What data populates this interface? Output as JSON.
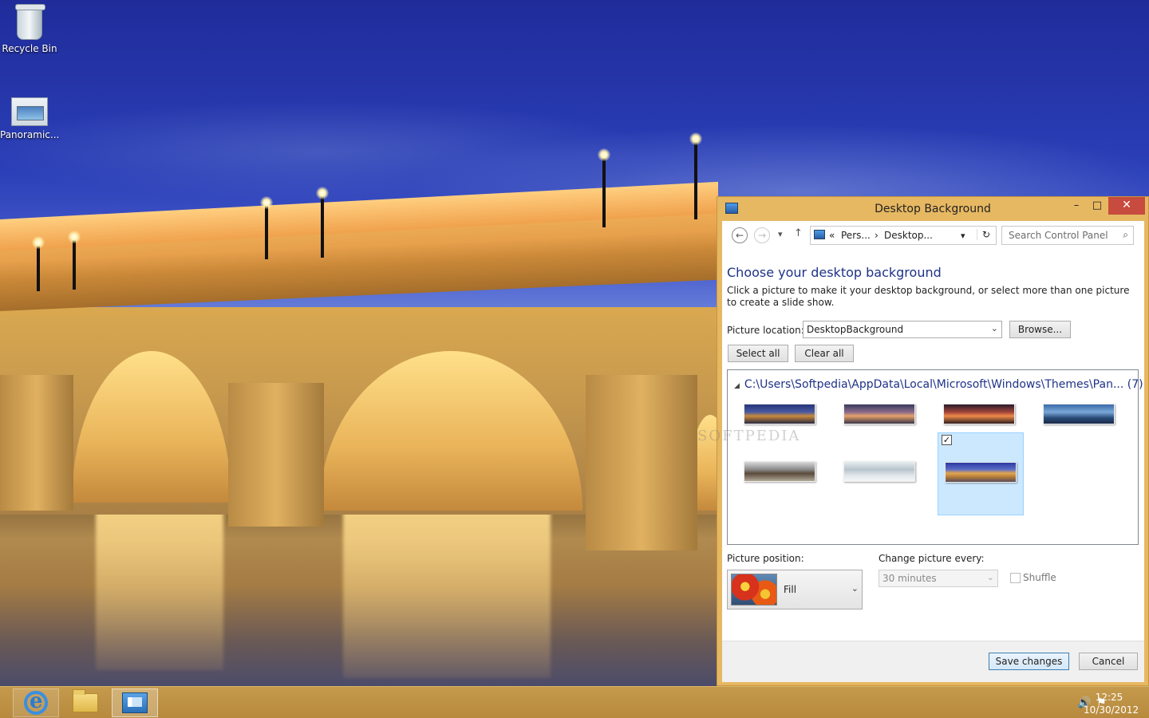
{
  "desktop": {
    "icons": [
      {
        "label": "Recycle Bin",
        "icon": "recycle-bin-icon"
      },
      {
        "label": "Panoramic...",
        "icon": "theme-pack-icon"
      }
    ]
  },
  "window": {
    "title": "Desktop Background",
    "controls": {
      "minimize": "–",
      "maximize": "□",
      "close": "✕"
    },
    "nav": {
      "back": "←",
      "forward": "→",
      "recent": "▾",
      "up": "↑",
      "address_sep": "«",
      "crumbs": [
        "Pers...",
        "Desktop..."
      ],
      "crumb_sep": "›",
      "dropdown": "▾",
      "refresh": "↻",
      "search_placeholder": "Search Control Panel",
      "search_icon": "⌕"
    },
    "heading": "Choose your desktop background",
    "description": "Click a picture to make it your desktop background, or select more than one picture to create a slide show.",
    "picture_location_label": "Picture location:",
    "picture_location_value": "DesktopBackground",
    "browse_label": "Browse...",
    "select_all_label": "Select all",
    "clear_all_label": "Clear all",
    "gallery": {
      "group_toggle": "◢",
      "group_path": "C:\\Users\\Softpedia\\AppData\\Local\\Microsoft\\Windows\\Themes\\Pan... (7)",
      "watermark": "SOFTPEDIA",
      "thumbnails": [
        {
          "name": "bridge-night",
          "selected": false
        },
        {
          "name": "bridge-sunset",
          "selected": false
        },
        {
          "name": "ferris-wheel-sunset",
          "selected": false
        },
        {
          "name": "city-bridge-blue",
          "selected": false
        },
        {
          "name": "golden-gate-clouds",
          "selected": false
        },
        {
          "name": "snowy-bridge",
          "selected": false
        },
        {
          "name": "pont-neuf-night",
          "selected": true
        }
      ],
      "checkmark": "✓"
    },
    "picture_position_label": "Picture position:",
    "picture_position_value": "Fill",
    "change_every_label": "Change picture every:",
    "change_every_value": "30 minutes",
    "shuffle_label": "Shuffle",
    "save_label": "Save changes",
    "cancel_label": "Cancel",
    "combo_arrow": "⌄"
  },
  "taskbar": {
    "apps": [
      {
        "name": "internet-explorer",
        "pinned": true,
        "active": false
      },
      {
        "name": "file-explorer",
        "pinned": true,
        "active": false
      },
      {
        "name": "control-panel",
        "pinned": false,
        "active": true
      }
    ],
    "tray": {
      "volume_icon": "🔊",
      "network_icon": "⚑"
    },
    "clock": {
      "time": "12:25",
      "date": "10/30/2012"
    }
  },
  "colors": {
    "accent_frame": "#e7b862",
    "close_button": "#c74b3e",
    "heading_blue": "#1e3287",
    "selection": "#cce8ff"
  }
}
